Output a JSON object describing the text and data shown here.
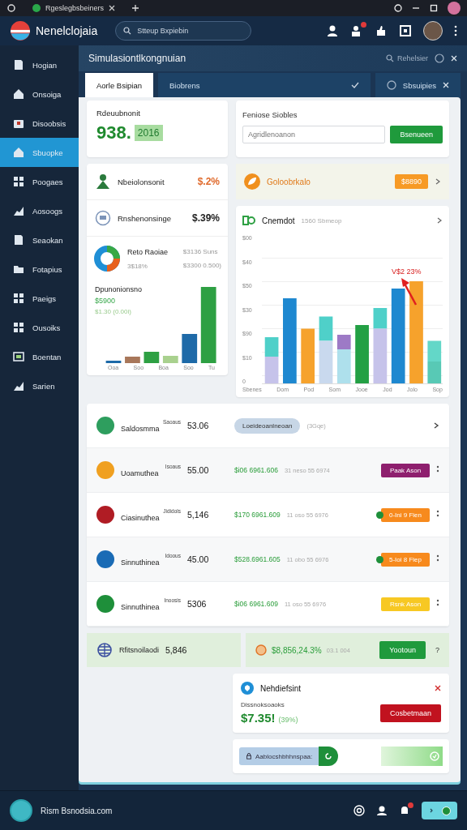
{
  "browser": {
    "tab_title": "Rgeslegbsbeiners"
  },
  "header": {
    "brand": "Nenelclojaia",
    "search": {
      "placeholder": "Stteup Bxpiebin"
    }
  },
  "sidebar": {
    "items": [
      {
        "label": "Hogian",
        "selected": false
      },
      {
        "label": "Onsoiga",
        "selected": false
      },
      {
        "label": "Disoobsis",
        "selected": false
      },
      {
        "label": "Sbuopke",
        "selected": true
      },
      {
        "label": "Poogaes",
        "selected": false
      },
      {
        "label": "Aosoogs",
        "selected": false
      },
      {
        "label": "Seaokan",
        "selected": false
      },
      {
        "label": "Fotapius",
        "selected": false
      },
      {
        "label": "Paeigs",
        "selected": false
      },
      {
        "label": "Ousoiks",
        "selected": false
      },
      {
        "label": "Boentan",
        "selected": false
      },
      {
        "label": "Sarien",
        "selected": false
      }
    ]
  },
  "page": {
    "title": "Simulasiontlkongnuian",
    "search_label": "Rehelsier"
  },
  "tabs": [
    {
      "label": "Aorle Bsipian",
      "selected": true
    },
    {
      "label": "Biobrens",
      "selected": false
    },
    {
      "label": "Sbsuipies",
      "selected": false
    }
  ],
  "summary": {
    "label": "Rdeuubnonit",
    "value": "938.",
    "badge": "2016"
  },
  "filter": {
    "title": "Feniose Siobles",
    "placeholder": "Agridlenoanon",
    "button": "Bsenueen"
  },
  "metrics": [
    {
      "name": "Nbeiolonsonit",
      "value": "$.2%",
      "color": "#e06a2c"
    },
    {
      "name": "Rnshenonsinge",
      "value": "$.39%",
      "color": "#222222"
    }
  ],
  "donut": {
    "title": "Reto Raoiae",
    "sub": "3$18%",
    "value_1": "$3136 Suns",
    "value_2": "$3300 0.500)"
  },
  "mini_chart": {
    "title": "Dpunonionsno",
    "value": "$5900",
    "sub": "$1.30 (0.00i)",
    "x_labels": [
      "Ooa",
      "Soo",
      "Boa",
      "Soo",
      "Tu"
    ]
  },
  "promo": {
    "label": "Goloobrkalo",
    "badge": "$8890"
  },
  "chart": {
    "title": "Cnemdot",
    "subtitle": "1560 Sbmeop",
    "y_labels": [
      "$00",
      "$40",
      "$50",
      "$30",
      "$90",
      "$10",
      "0"
    ],
    "x_labels": [
      "Sbenes",
      "Dom",
      "Pod",
      "Som",
      "Jooe",
      "Jod",
      "Jolo",
      "Sop"
    ],
    "annotation": "V$2 23%"
  },
  "table": {
    "rows": [
      {
        "kind": "pill",
        "name": "Saldosmma",
        "tag": "Saoaus",
        "value": "53.06",
        "pill": "Loeideoanlneoan",
        "note": "(3Gqe)",
        "icon": {
          "color": "#2e9e5e"
        }
      },
      {
        "kind": "status",
        "name": "Uoamuthea",
        "tag": "Isoaus",
        "value": "55.00",
        "amount": "$i06 6961.606",
        "note": "31 neso 55 6974",
        "status": "Paak Ason",
        "color": "#8e1f6e",
        "dot": false,
        "icon": {
          "color": "#f0a020"
        }
      },
      {
        "kind": "status",
        "name": "Ciasinuthea",
        "tag": "Jididols",
        "value": "5,146",
        "amount": "$170 6961.609",
        "note": "11 oso 55 6976",
        "status": "0-Ini 9 Fien",
        "color": "#f78a1d",
        "dot": true,
        "icon": {
          "color": "#b01c24"
        }
      },
      {
        "kind": "status",
        "name": "Sinnuthinea",
        "tag": "Idoous",
        "value": "45.00",
        "amount": "$528.6961.605",
        "note": "11 obo 55 6976",
        "status": "5-Ioi 8 Fiep",
        "color": "#f78a1d",
        "dot": true,
        "icon": {
          "color": "#1a6bb5"
        }
      },
      {
        "kind": "status",
        "name": "Sinnuthinea",
        "tag": "Inoosis",
        "value": "5306",
        "amount": "$i06 6961.609",
        "note": "11 oso 55 6976",
        "status": "Rsnk Ason",
        "color": "#f7c823",
        "dot": false,
        "icon": {
          "color": "#1e8f3a"
        }
      }
    ]
  },
  "highlight": {
    "name": "Rfitsnoilaodi",
    "value": "5,846",
    "amount": "$8,856,24.3%",
    "note": "03.1 004",
    "button": "Yootoun",
    "help": "?"
  },
  "notification": {
    "title": "Nehdiefsint",
    "label": "Dissnoksoaoks",
    "value": "$7.35!",
    "change": "(39%)",
    "button": "Cosbetmaan"
  },
  "composer": {
    "value": "Aablocshbhhnspaa:",
    "toggle_on": true
  },
  "footer": {
    "site": "Rism Bsnodsia.com",
    "status_on": true
  }
}
